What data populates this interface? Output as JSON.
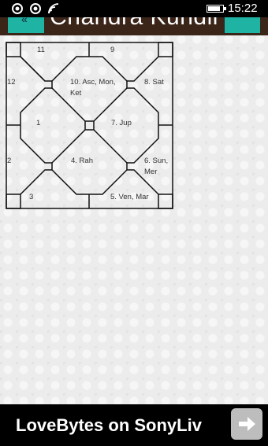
{
  "status_bar": {
    "time": "15:22"
  },
  "app_bar": {
    "title": "Chandra Kundli"
  },
  "chart": {
    "houses": [
      {
        "id": "11",
        "text": "11"
      },
      {
        "id": "9",
        "text": "9"
      },
      {
        "id": "12",
        "text": "12"
      },
      {
        "id": "10",
        "text": "10. Asc, Mon, Ket"
      },
      {
        "id": "8",
        "text": "8. Sat"
      },
      {
        "id": "1",
        "text": "1"
      },
      {
        "id": "7",
        "text": "7. Jup"
      },
      {
        "id": "2",
        "text": "2"
      },
      {
        "id": "4",
        "text": "4. Rah"
      },
      {
        "id": "6",
        "text": "6. Sun, Mer"
      },
      {
        "id": "3",
        "text": "3"
      },
      {
        "id": "5",
        "text": "5. Ven, Mar"
      }
    ]
  },
  "ad": {
    "text": "LoveBytes on SonyLiv"
  }
}
